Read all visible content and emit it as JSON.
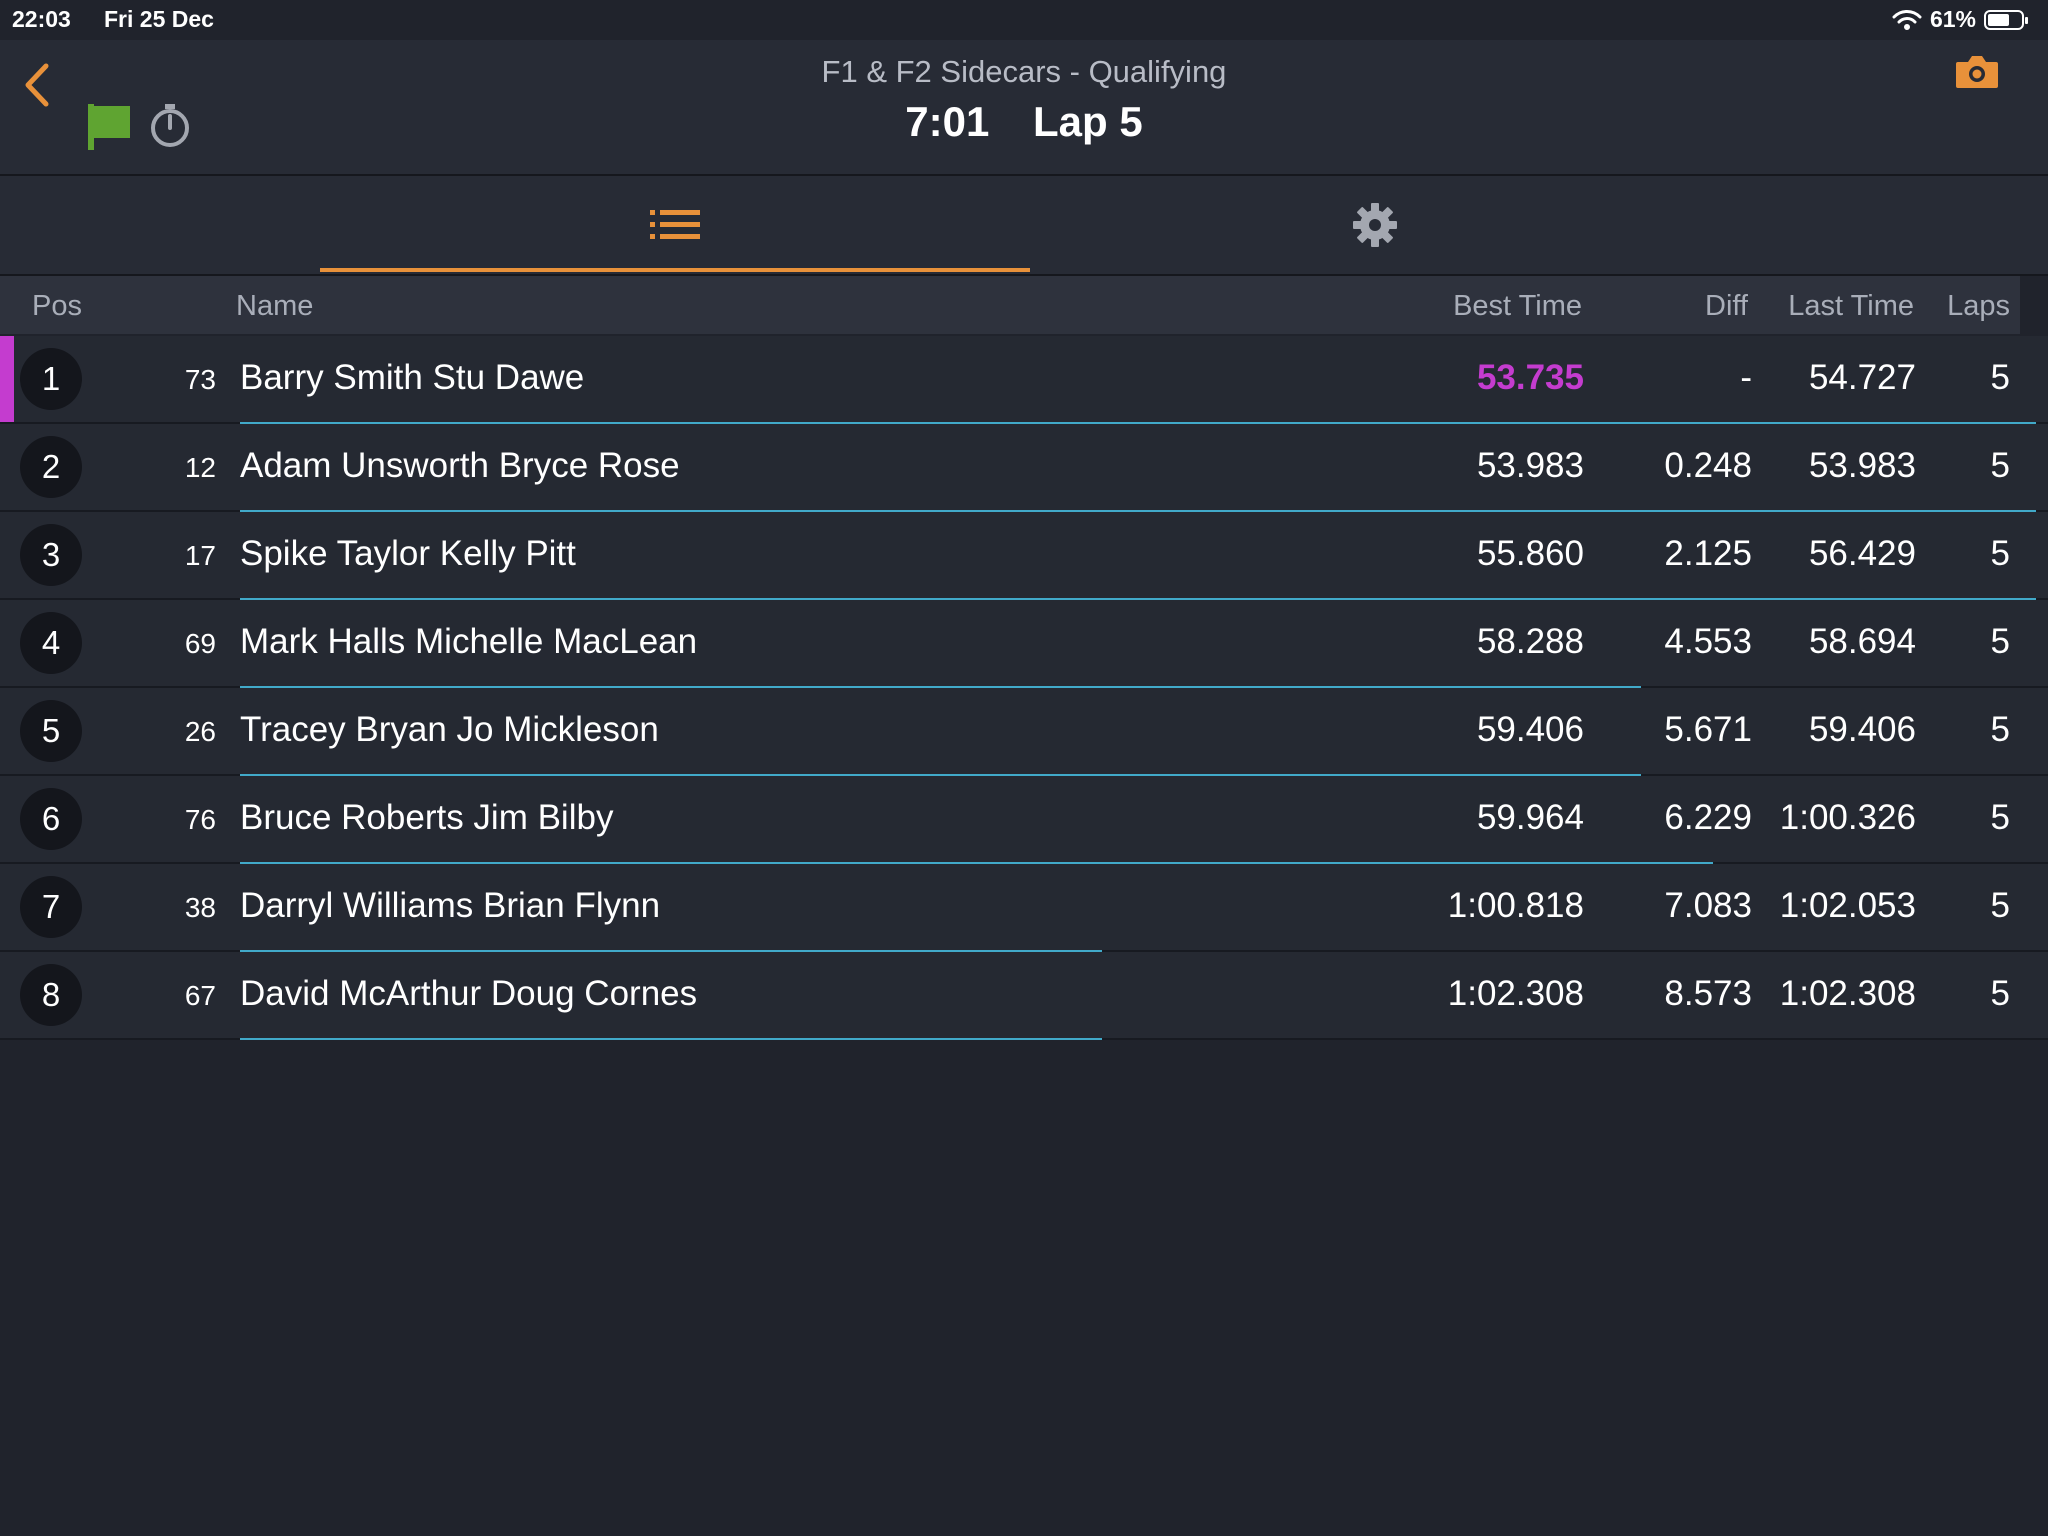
{
  "status_bar": {
    "time": "22:03",
    "date": "Fri 25 Dec",
    "battery": "61%"
  },
  "header": {
    "title": "F1 & F2 Sidecars - Qualifying",
    "clock": "7:01",
    "lap": "Lap 5",
    "icons": {
      "back": "chevron-left-icon",
      "flag": "green-flag-icon",
      "timer": "stopwatch-icon",
      "camera": "camera-icon"
    }
  },
  "tabs": [
    {
      "name": "list",
      "icon": "list-icon",
      "active": true
    },
    {
      "name": "settings",
      "icon": "gear-icon",
      "active": false
    }
  ],
  "colors": {
    "accent": "#e8913a",
    "fastest": "#c43ccf",
    "progress": "#41a9c9",
    "flag": "#5fa431",
    "background": "#20232c"
  },
  "table": {
    "columns": {
      "pos": "Pos",
      "name": "Name",
      "best": "Best Time",
      "diff": "Diff",
      "last": "Last Time",
      "laps": "Laps"
    },
    "rows": [
      {
        "pos": "1",
        "num": "73",
        "name": "Barry Smith Stu Dawe",
        "best": "53.735",
        "diff": "-",
        "last": "54.727",
        "laps": "5",
        "fastest": true,
        "progress": 1.0
      },
      {
        "pos": "2",
        "num": "12",
        "name": "Adam Unsworth Bryce Rose",
        "best": "53.983",
        "diff": "0.248",
        "last": "53.983",
        "laps": "5",
        "fastest": false,
        "progress": 1.0
      },
      {
        "pos": "3",
        "num": "17",
        "name": "Spike Taylor Kelly Pitt",
        "best": "55.860",
        "diff": "2.125",
        "last": "56.429",
        "laps": "5",
        "fastest": false,
        "progress": 1.0
      },
      {
        "pos": "4",
        "num": "69",
        "name": "Mark Halls Michelle MacLean",
        "best": "58.288",
        "diff": "4.553",
        "last": "58.694",
        "laps": "5",
        "fastest": false,
        "progress": 0.78
      },
      {
        "pos": "5",
        "num": "26",
        "name": "Tracey Bryan Jo Mickleson",
        "best": "59.406",
        "diff": "5.671",
        "last": "59.406",
        "laps": "5",
        "fastest": false,
        "progress": 0.78
      },
      {
        "pos": "6",
        "num": "76",
        "name": "Bruce Roberts Jim Bilby",
        "best": "59.964",
        "diff": "6.229",
        "last": "1:00.326",
        "laps": "5",
        "fastest": false,
        "progress": 0.82
      },
      {
        "pos": "7",
        "num": "38",
        "name": "Darryl Williams Brian Flynn",
        "best": "1:00.818",
        "diff": "7.083",
        "last": "1:02.053",
        "laps": "5",
        "fastest": false,
        "progress": 0.48
      },
      {
        "pos": "8",
        "num": "67",
        "name": "David McArthur Doug Cornes",
        "best": "1:02.308",
        "diff": "8.573",
        "last": "1:02.308",
        "laps": "5",
        "fastest": false,
        "progress": 0.48
      }
    ]
  }
}
